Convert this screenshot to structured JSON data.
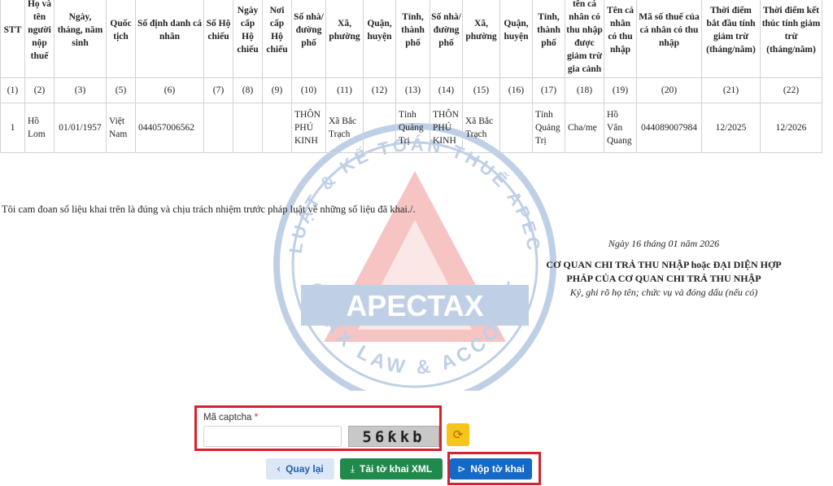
{
  "table": {
    "headers": [
      "STT",
      "Họ và tên người nộp thuế",
      "Ngày, tháng, năm sinh",
      "Quốc tịch",
      "Số định danh cá nhân",
      "Số Hộ chiếu",
      "Ngày cấp Hộ chiếu",
      "Nơi cấp Hộ chiếu",
      "Số nhà/ đường phố",
      "Xã, phường",
      "Quận, huyện",
      "Tỉnh, thành phố",
      "Số nhà/ đường phố",
      "Xã, phường",
      "Quận, huyện",
      "Tỉnh, thành phố",
      "Họ và tên cá nhân có thu nhập được giảm trừ gia cảnh",
      "Tên cá nhân có thu nhập",
      "Mã số thuế của cá nhân có thu nhập",
      "Thời điểm bắt đầu tính giảm trừ (tháng/năm)",
      "Thời điểm kết thúc tính giảm trừ (tháng/năm)"
    ],
    "index_row": [
      "(1)",
      "(2)",
      "(3)",
      "(5)",
      "(6)",
      "(7)",
      "(8)",
      "(9)",
      "(10)",
      "(11)",
      "(12)",
      "(13)",
      "(14)",
      "(15)",
      "(16)",
      "(17)",
      "(18)",
      "(19)",
      "(20)",
      "(21)",
      "(22)"
    ],
    "rows": [
      [
        "1",
        "Hồ Lom",
        "01/01/1957",
        "Việt Nam",
        "044057006562",
        "",
        "",
        "",
        "THÔN PHÚ KINH",
        "Xã Bắc Trạch",
        "",
        "Tỉnh Quảng Trị",
        "THÔN PHÚ KINH",
        "Xã Bắc Trạch",
        "",
        "Tỉnh Quảng Trị",
        "Cha/mẹ",
        "Hồ Văn Quang",
        "044089007984",
        "12/2025",
        "12/2026"
      ]
    ]
  },
  "pledge": "Tôi cam đoan số liệu khai trên là đúng và chịu trách nhiệm trước pháp luật về những số liệu đã khai./.",
  "signature": {
    "date": "Ngày 16 tháng 01 năm 2026",
    "org_line1": "CƠ QUAN CHI TRẢ THU NHẬP hoặc ĐẠI DIỆN HỢP",
    "org_line2": "PHÁP CỦA CƠ QUAN CHI TRẢ THU NHẬP",
    "note": "Ký, ghi rõ họ tên; chức vụ và đóng dấu (nếu có)"
  },
  "watermark": {
    "brand": "APECTAX",
    "tagline": "APEC TAX LAW & ACCOUNTING",
    "top_text": "LUẬT & KẾ TOÁN THUẾ APEC"
  },
  "captcha": {
    "label": "Mã captcha",
    "required_mark": "*",
    "value": "",
    "image_text": "56ƙkb"
  },
  "buttons": {
    "back_label": "Quay lại",
    "xml_label": "Tải tờ khai XML",
    "submit_label": "Nộp tờ khai"
  },
  "icons": {
    "back": "chevron-left-icon",
    "download": "download-icon",
    "submit": "send-icon",
    "refresh": "refresh-icon"
  },
  "colors": {
    "highlight_red": "#d7212f",
    "back_bg": "#dbe7f6",
    "xml_green": "#1f8a4c",
    "submit_blue": "#1569c7",
    "refresh_yellow": "#f5c518",
    "watermark_red": "#e0302a",
    "watermark_blue": "#1d5aa8"
  }
}
